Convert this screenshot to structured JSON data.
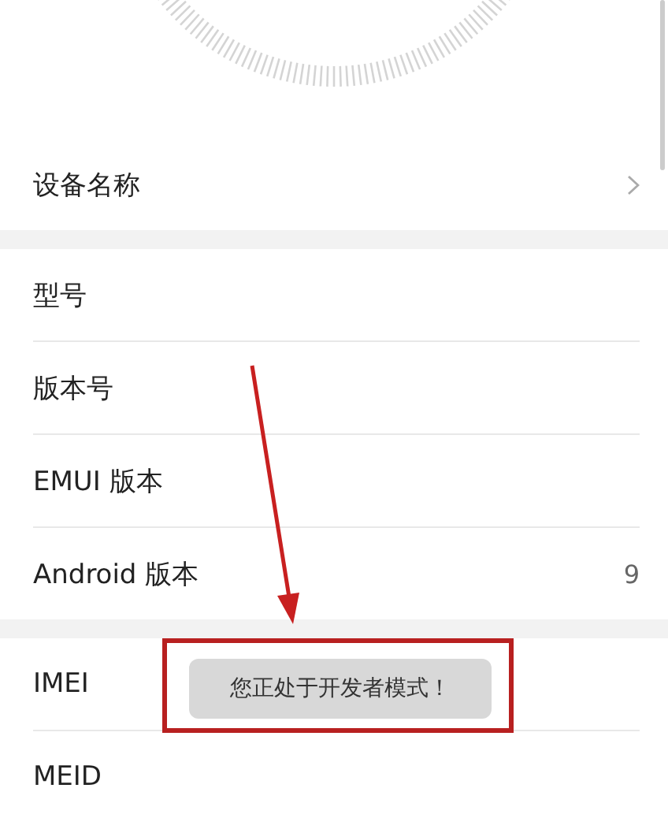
{
  "groups": [
    {
      "rows": [
        {
          "label": "设备名称",
          "value": "",
          "chevron": true
        }
      ]
    },
    {
      "rows": [
        {
          "label": "型号",
          "value": "",
          "chevron": false
        },
        {
          "label": "版本号",
          "value": "",
          "chevron": false
        },
        {
          "label": "EMUI 版本",
          "value": "",
          "chevron": false
        },
        {
          "label": "Android 版本",
          "value": "9",
          "chevron": false
        }
      ]
    },
    {
      "rows": [
        {
          "label": "IMEI",
          "value": "",
          "chevron": false
        },
        {
          "label": "MEID",
          "value": "",
          "chevron": false
        }
      ]
    }
  ],
  "toast": {
    "text": "您正处于开发者模式！"
  }
}
